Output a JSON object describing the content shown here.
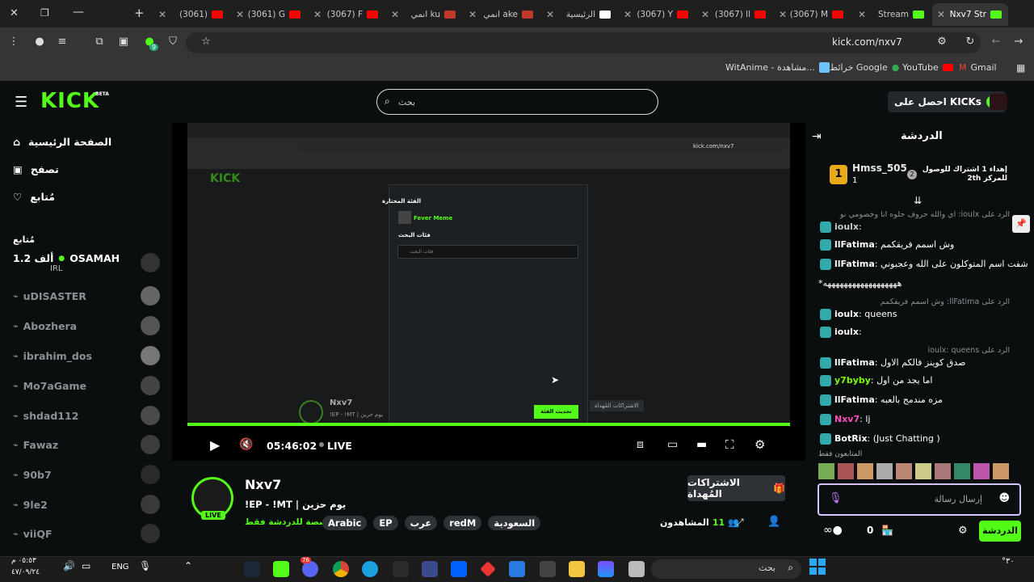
{
  "browser": {
    "tabs": [
      {
        "label": "(3061)",
        "fav": "#ff0000"
      },
      {
        "label": "(3061) G",
        "fav": "#ff0000"
      },
      {
        "label": "(3067) F",
        "fav": "#ff0000"
      },
      {
        "label": "انمي ku",
        "fav": "#c0392b"
      },
      {
        "label": "انمي ake",
        "fav": "#c0392b"
      },
      {
        "label": "الرئيسية",
        "fav": "#ffffff"
      },
      {
        "label": "(3067) Y",
        "fav": "#ff0000"
      },
      {
        "label": "(3067) ll",
        "fav": "#ff0000"
      },
      {
        "label": "(3067) M",
        "fav": "#ff0000"
      },
      {
        "label": "Stream",
        "fav": "#53fc18"
      },
      {
        "label": "Nxv7 Str",
        "fav": "#53fc18"
      }
    ],
    "url": "kick.com/nxv7",
    "bookmarks": {
      "gmail": "Gmail",
      "youtube": "YouTube",
      "maps": "خرائط Google",
      "witanime": "WitAnime - مشاهدة..."
    },
    "extension_badge": "9"
  },
  "kick": {
    "logo": "KICK",
    "logo_badge": "BETA",
    "search_placeholder": "بحث",
    "get_kicks": "احصل على KICKs",
    "nav": {
      "home": "الصفحة الرئيسية",
      "browse": "تصفح",
      "following": "مُتابع"
    },
    "following_title": "مُتابع",
    "followed": [
      {
        "name": "OSAMAH",
        "viewers": "1.2 ألف",
        "category": "IRL",
        "live": true
      },
      {
        "name": "uDISASTER",
        "live": false
      },
      {
        "name": "Abozhera",
        "live": false
      },
      {
        "name": "ibrahim_dos",
        "live": false
      },
      {
        "name": "Mo7aGame",
        "live": false
      },
      {
        "name": "shdad112",
        "live": false
      },
      {
        "name": "Fawaz",
        "live": false
      },
      {
        "name": "90b7",
        "live": false
      },
      {
        "name": "9le2",
        "live": false
      },
      {
        "name": "viiQF",
        "live": false
      }
    ]
  },
  "player": {
    "time": "05:46:02",
    "live_label": "LIVE",
    "progress_fraction": 1.0
  },
  "inner_screen": {
    "dialog": {
      "section_selected": "الفئة المختارة",
      "selected_category": "Fever Meme",
      "search_section": "فئات البحث",
      "search_placeholder": "فئات البحث",
      "update_button": "تحديث الفئة"
    },
    "streamer": "Nxv7",
    "title": "!EP - !MT | يوم حزين",
    "sub_gift": "الاشتراكات المُهداة"
  },
  "stream": {
    "streamer": "Nxv7",
    "title": "!EP - !MT | يوم حزين",
    "category": "مخصصة للدردشة فقط",
    "live_badge": "LIVE",
    "tags": [
      "السعودية",
      "redM",
      "عرب",
      "EP",
      "Arabic"
    ],
    "viewers_count": "11",
    "viewers_label": "المشاهدون",
    "subs_gift_button": "الاشتراكات المُهداة"
  },
  "chat": {
    "title": "الدردشة",
    "top_gifter": {
      "name": "Hmss_505",
      "rank": "1",
      "count": "1"
    },
    "second_note": "إهداء 1 اشتراك للوصول للمركز 2th",
    "second_rank": "2",
    "messages": [
      {
        "user": "ioulx",
        "reply": "الرد على ioulx: اي والله حروف حلوه انا وخصومي نو",
        "text": "",
        "color": "#c9c9c9"
      },
      {
        "user": "llFatima",
        "text": "وش اسمم فريقكمم",
        "color": "#ffffff"
      },
      {
        "user": "llFatima",
        "text": "شفت اسم المتوكلون على الله وعجبوني",
        "color": "#ffffff"
      },
      {
        "user": "",
        "text": "*ههههههههههههههههههه",
        "color": "#ffffff"
      },
      {
        "user": "ioulx",
        "reply": "الرد على llFatima: وش اسمم فريقكمم",
        "text": "queens",
        "color": "#ffffff"
      },
      {
        "user": "ioulx",
        "text": "",
        "color": "#ffffff"
      },
      {
        "user": "llFatima",
        "reply": "الرد على ioulx: queens",
        "text": "صدق كوينز فالكم الاول",
        "color": "#ffffff"
      },
      {
        "user": "y7byby",
        "text": "اما يجد من اول",
        "color": "#7cfc00"
      },
      {
        "user": "llFatima",
        "text": "مزه مندمج بالعبه",
        "color": "#ffffff"
      },
      {
        "user": "Nxv7",
        "text": "lj",
        "color": "#ff4bbd"
      },
      {
        "user": "BotRix",
        "text": "(Just Chatting )",
        "color": "#ffffff"
      }
    ],
    "viewers_only_label": "المتابعون فقط",
    "input_placeholder": "إرسال رسالة",
    "send_button": "الدردشة",
    "points": "0"
  },
  "taskbar": {
    "search_placeholder": "بحث",
    "lang": "ENG",
    "time": "٠٥:٥٣ م",
    "date": "٤٧/٠٩/٢٤",
    "temp": "°٣٠",
    "discord_badge": "76"
  },
  "colors": {
    "kick_green": "#53fc18",
    "bg": "#0b0e0f"
  }
}
